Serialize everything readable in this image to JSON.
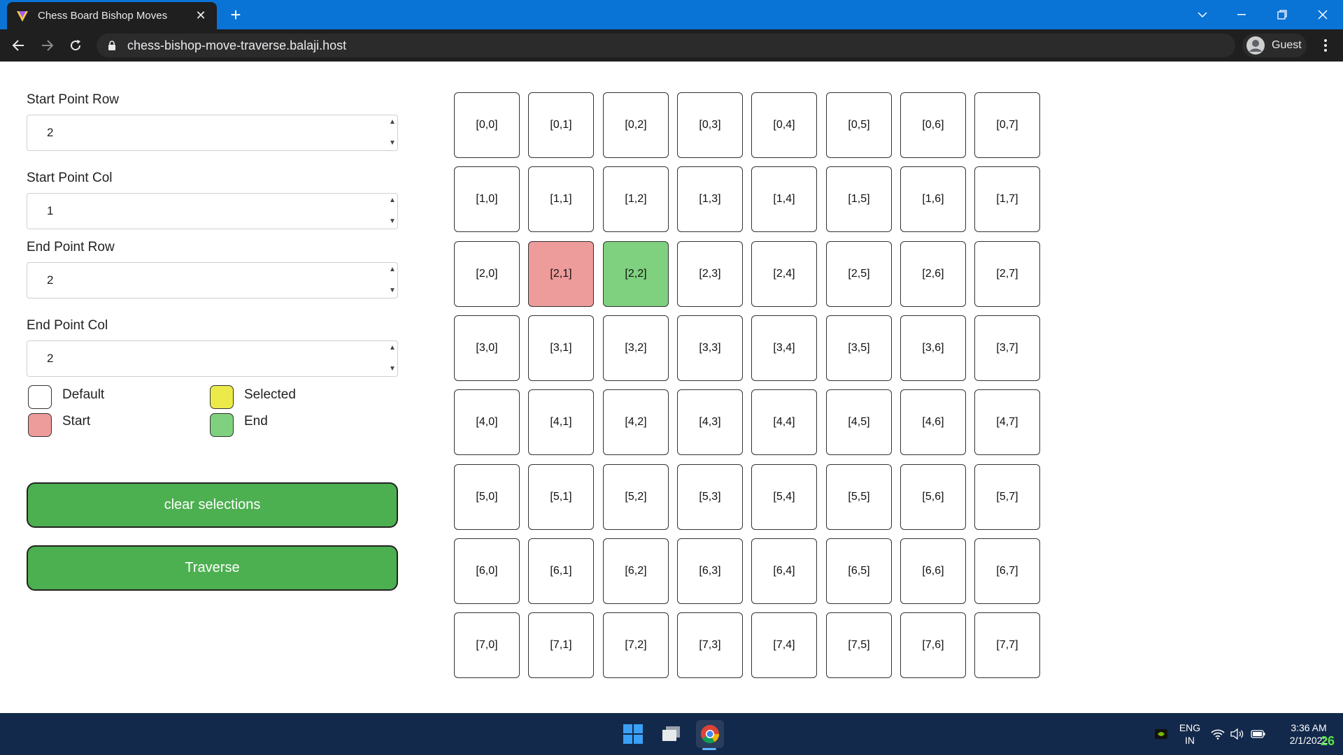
{
  "browser": {
    "tab_title": "Chess Board Bishop Moves",
    "tab_close": "✕",
    "new_tab": "+",
    "url": "chess-bishop-move-traverse.balaji.host",
    "profile_label": "Guest"
  },
  "controls": {
    "start_row": {
      "label": "Start Point Row",
      "value": "2"
    },
    "start_col": {
      "label": "Start Point Col",
      "value": "1"
    },
    "end_row": {
      "label": "End Point Row",
      "value": "2"
    },
    "end_col": {
      "label": "End Point Col",
      "value": "2"
    }
  },
  "legend": {
    "default": {
      "label": "Default",
      "color": "#ffffff"
    },
    "selected": {
      "label": "Selected",
      "color": "#ecea4a"
    },
    "start": {
      "label": "Start",
      "color": "#ee9b9b"
    },
    "end": {
      "label": "End",
      "color": "#7fd17f"
    }
  },
  "buttons": {
    "clear": "clear selections",
    "traverse": "Traverse",
    "color": "#4caf50"
  },
  "board": {
    "rows": 8,
    "cols": 8,
    "start": [
      2,
      1
    ],
    "end": [
      2,
      2
    ],
    "selected": []
  },
  "taskbar": {
    "lang_line1": "ENG",
    "lang_line2": "IN",
    "time": "3:36 AM",
    "date": "2/1/2022",
    "badge": "26"
  }
}
